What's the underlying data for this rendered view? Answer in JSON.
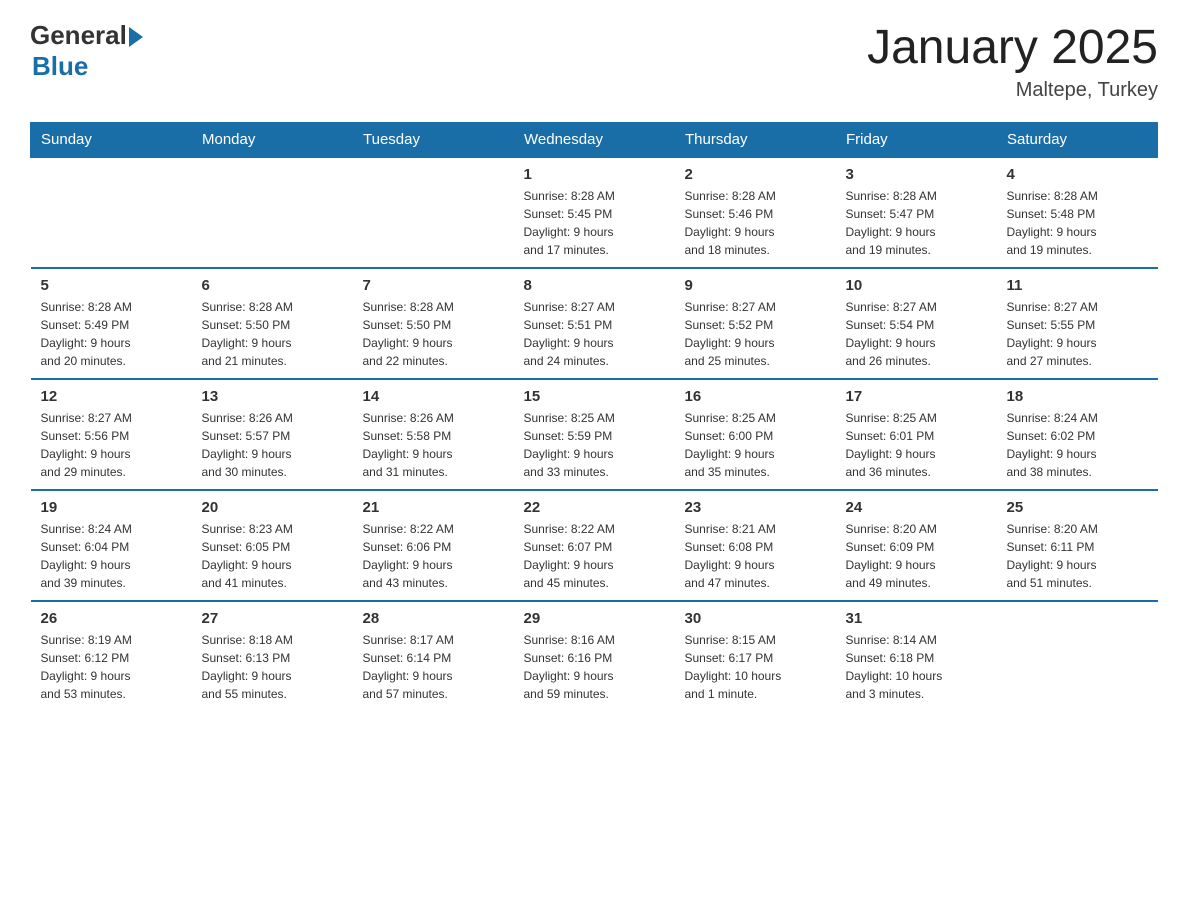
{
  "header": {
    "logo": {
      "general": "General",
      "blue": "Blue"
    },
    "title": "January 2025",
    "subtitle": "Maltepe, Turkey"
  },
  "calendar": {
    "days_of_week": [
      "Sunday",
      "Monday",
      "Tuesday",
      "Wednesday",
      "Thursday",
      "Friday",
      "Saturday"
    ],
    "weeks": [
      [
        {
          "day": "",
          "info": ""
        },
        {
          "day": "",
          "info": ""
        },
        {
          "day": "",
          "info": ""
        },
        {
          "day": "1",
          "info": "Sunrise: 8:28 AM\nSunset: 5:45 PM\nDaylight: 9 hours\nand 17 minutes."
        },
        {
          "day": "2",
          "info": "Sunrise: 8:28 AM\nSunset: 5:46 PM\nDaylight: 9 hours\nand 18 minutes."
        },
        {
          "day": "3",
          "info": "Sunrise: 8:28 AM\nSunset: 5:47 PM\nDaylight: 9 hours\nand 19 minutes."
        },
        {
          "day": "4",
          "info": "Sunrise: 8:28 AM\nSunset: 5:48 PM\nDaylight: 9 hours\nand 19 minutes."
        }
      ],
      [
        {
          "day": "5",
          "info": "Sunrise: 8:28 AM\nSunset: 5:49 PM\nDaylight: 9 hours\nand 20 minutes."
        },
        {
          "day": "6",
          "info": "Sunrise: 8:28 AM\nSunset: 5:50 PM\nDaylight: 9 hours\nand 21 minutes."
        },
        {
          "day": "7",
          "info": "Sunrise: 8:28 AM\nSunset: 5:50 PM\nDaylight: 9 hours\nand 22 minutes."
        },
        {
          "day": "8",
          "info": "Sunrise: 8:27 AM\nSunset: 5:51 PM\nDaylight: 9 hours\nand 24 minutes."
        },
        {
          "day": "9",
          "info": "Sunrise: 8:27 AM\nSunset: 5:52 PM\nDaylight: 9 hours\nand 25 minutes."
        },
        {
          "day": "10",
          "info": "Sunrise: 8:27 AM\nSunset: 5:54 PM\nDaylight: 9 hours\nand 26 minutes."
        },
        {
          "day": "11",
          "info": "Sunrise: 8:27 AM\nSunset: 5:55 PM\nDaylight: 9 hours\nand 27 minutes."
        }
      ],
      [
        {
          "day": "12",
          "info": "Sunrise: 8:27 AM\nSunset: 5:56 PM\nDaylight: 9 hours\nand 29 minutes."
        },
        {
          "day": "13",
          "info": "Sunrise: 8:26 AM\nSunset: 5:57 PM\nDaylight: 9 hours\nand 30 minutes."
        },
        {
          "day": "14",
          "info": "Sunrise: 8:26 AM\nSunset: 5:58 PM\nDaylight: 9 hours\nand 31 minutes."
        },
        {
          "day": "15",
          "info": "Sunrise: 8:25 AM\nSunset: 5:59 PM\nDaylight: 9 hours\nand 33 minutes."
        },
        {
          "day": "16",
          "info": "Sunrise: 8:25 AM\nSunset: 6:00 PM\nDaylight: 9 hours\nand 35 minutes."
        },
        {
          "day": "17",
          "info": "Sunrise: 8:25 AM\nSunset: 6:01 PM\nDaylight: 9 hours\nand 36 minutes."
        },
        {
          "day": "18",
          "info": "Sunrise: 8:24 AM\nSunset: 6:02 PM\nDaylight: 9 hours\nand 38 minutes."
        }
      ],
      [
        {
          "day": "19",
          "info": "Sunrise: 8:24 AM\nSunset: 6:04 PM\nDaylight: 9 hours\nand 39 minutes."
        },
        {
          "day": "20",
          "info": "Sunrise: 8:23 AM\nSunset: 6:05 PM\nDaylight: 9 hours\nand 41 minutes."
        },
        {
          "day": "21",
          "info": "Sunrise: 8:22 AM\nSunset: 6:06 PM\nDaylight: 9 hours\nand 43 minutes."
        },
        {
          "day": "22",
          "info": "Sunrise: 8:22 AM\nSunset: 6:07 PM\nDaylight: 9 hours\nand 45 minutes."
        },
        {
          "day": "23",
          "info": "Sunrise: 8:21 AM\nSunset: 6:08 PM\nDaylight: 9 hours\nand 47 minutes."
        },
        {
          "day": "24",
          "info": "Sunrise: 8:20 AM\nSunset: 6:09 PM\nDaylight: 9 hours\nand 49 minutes."
        },
        {
          "day": "25",
          "info": "Sunrise: 8:20 AM\nSunset: 6:11 PM\nDaylight: 9 hours\nand 51 minutes."
        }
      ],
      [
        {
          "day": "26",
          "info": "Sunrise: 8:19 AM\nSunset: 6:12 PM\nDaylight: 9 hours\nand 53 minutes."
        },
        {
          "day": "27",
          "info": "Sunrise: 8:18 AM\nSunset: 6:13 PM\nDaylight: 9 hours\nand 55 minutes."
        },
        {
          "day": "28",
          "info": "Sunrise: 8:17 AM\nSunset: 6:14 PM\nDaylight: 9 hours\nand 57 minutes."
        },
        {
          "day": "29",
          "info": "Sunrise: 8:16 AM\nSunset: 6:16 PM\nDaylight: 9 hours\nand 59 minutes."
        },
        {
          "day": "30",
          "info": "Sunrise: 8:15 AM\nSunset: 6:17 PM\nDaylight: 10 hours\nand 1 minute."
        },
        {
          "day": "31",
          "info": "Sunrise: 8:14 AM\nSunset: 6:18 PM\nDaylight: 10 hours\nand 3 minutes."
        },
        {
          "day": "",
          "info": ""
        }
      ]
    ]
  }
}
